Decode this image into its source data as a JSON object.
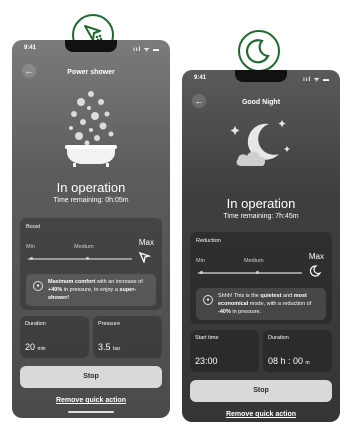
{
  "screens": [
    {
      "status_time": "9:41",
      "status_icons": "ııl ᯤ ▬",
      "title": "Power shower",
      "state": "In operation",
      "time_remaining": "Time remaining: 0h:05m",
      "level_card": {
        "label": "Boost",
        "levels": [
          "Min",
          "Medium",
          "Max"
        ],
        "selected": "Max"
      },
      "info": {
        "pre": "",
        "bold1": "Maximum comfort",
        "mid1": " with an increase of ",
        "bold2": "+40%",
        "mid2": " in pressure, to enjoy a ",
        "bold3": "super-shower!",
        "post": ""
      },
      "stat1": {
        "label": "Duration",
        "value": "20",
        "unit": "min"
      },
      "stat2": {
        "label": "Pressure",
        "value": "3.5",
        "unit": "bar"
      },
      "stop_label": "Stop",
      "remove_label": "Remove quick action"
    },
    {
      "status_time": "9:41",
      "status_icons": "ııl ᯤ ▬",
      "title": "Good Night",
      "state": "In operation",
      "time_remaining": "Time remaining: 7h:45m",
      "level_card": {
        "label": "Reduction",
        "levels": [
          "Min",
          "Medium",
          "Max"
        ],
        "selected": "Max"
      },
      "info": {
        "pre": "Shhh! This is the ",
        "bold1": "quietest",
        "mid1": " and ",
        "bold2": "most economical",
        "mid2": " mode, with a reduction of ",
        "bold3": "-40%",
        "post": " in pressure."
      },
      "stat1": {
        "label": "Start time",
        "value": "23:00",
        "unit": ""
      },
      "stat2": {
        "label": "Duration",
        "value": "08 h : 00",
        "unit": "m"
      },
      "stop_label": "Stop",
      "remove_label": "Remove quick action"
    }
  ],
  "colors": {
    "badge_green": "#1f6b2e",
    "stop_button": "#d9d9d9"
  }
}
